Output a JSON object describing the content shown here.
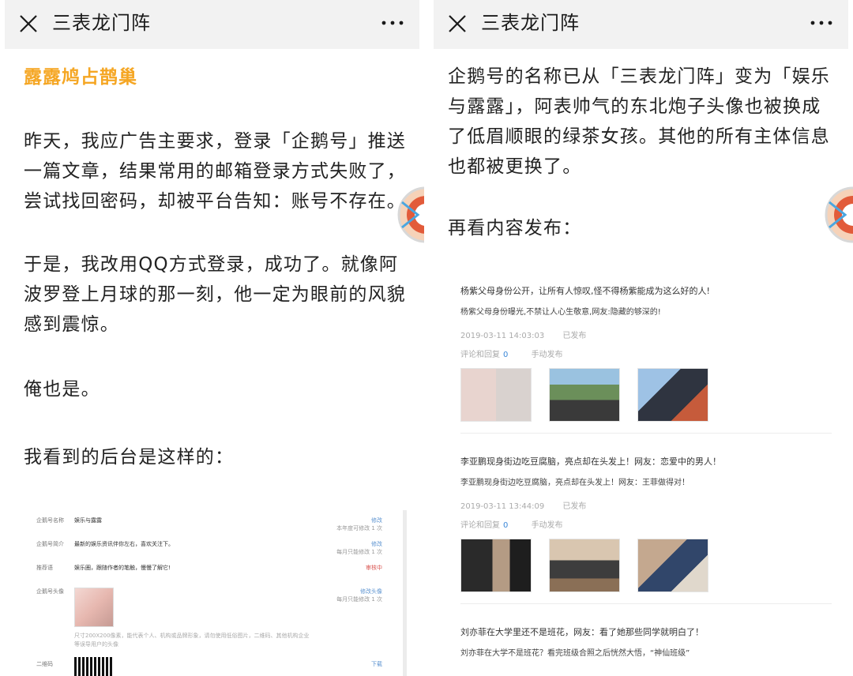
{
  "nav": {
    "title": "三表龙门阵"
  },
  "left": {
    "article_title": "露露鸠占鹊巢",
    "paragraphs": [
      "昨天，我应广告主要求，登录「企鹅号」推送一篇文章，结果常用的邮箱登录方式失败了，尝试找回密码，却被平台告知：账号不存在。",
      "于是，我改用QQ方式登录，成功了。就像阿波罗登上月球的那一刻，他一定为眼前的风貌感到震惊。",
      "俺也是。",
      "我看到的后台是这样的："
    ],
    "backend": {
      "rows": [
        {
          "label": "企鹅号名称",
          "value": "娱乐与露露",
          "action": "修改",
          "note": "本年度可修改 1 次"
        },
        {
          "label": "企鹅号简介",
          "value": "最新的娱乐资讯伴你左右，喜欢关注下。",
          "action": "修改",
          "note": "每月只能修改 1 次"
        },
        {
          "label": "推荐语",
          "value": "娱乐圈，跟随作者的笔触，慢慢了解它!",
          "action": "审核中",
          "note": ""
        },
        {
          "label": "企鹅号头像",
          "value": "",
          "action": "修改头像",
          "note": "每月只能修改 1 次"
        },
        {
          "label": "二维码",
          "value": "",
          "action": "下载",
          "note": ""
        }
      ],
      "avatar_hint": "尺寸200X200像素，能代表个人、机构或品牌形象，请勿使用低俗图片，二维码、其他机构企业等误导用户的头像"
    }
  },
  "right": {
    "paragraphs": [
      "企鹅号的名称已从「三表龙门阵」变为「娱乐与露露」，阿表帅气的东北炮子头像也被换成了低眉顺眼的绿茶女孩。其他的所有主体信息也都被更换了。",
      "再看内容发布："
    ],
    "items": [
      {
        "title": "杨紫父母身份公开，让所有人惊叹,怪不得杨紫能成为这么好的人!",
        "subtitle": "杨紫父母身份曝光,不禁让人心生敬意,网友:隐藏的够深的!",
        "time": "2019-03-11 14:03:03",
        "status": "已发布",
        "comments_label": "评论和回复",
        "comments_count": "0",
        "publish_mode": "手动发布"
      },
      {
        "title": "李亚鹏现身街边吃豆腐脑，亮点却在头发上！网友：恋爱中的男人！",
        "subtitle": "李亚鹏现身街边吃豆腐脑，亮点却在头发上！网友：王菲做得对！",
        "time": "2019-03-11 13:44:09",
        "status": "已发布",
        "comments_label": "评论和回复",
        "comments_count": "0",
        "publish_mode": "手动发布"
      },
      {
        "title": "刘亦菲在大学里还不是班花，网友：看了她那些同学就明白了！",
        "subtitle": "刘亦菲在大学不是班花？看完班级合照之后恍然大悟，“神仙班级”",
        "time": "",
        "status": "",
        "comments_label": "",
        "comments_count": "",
        "publish_mode": ""
      }
    ]
  },
  "icons": {
    "close": "close-icon",
    "more": "more-icon",
    "float": "floating-mascot-icon"
  },
  "colors": {
    "title_orange": "#f5a623",
    "nav_bg": "#f2f2f2",
    "link_blue": "#5c93d0",
    "review_red": "#d9534f"
  }
}
